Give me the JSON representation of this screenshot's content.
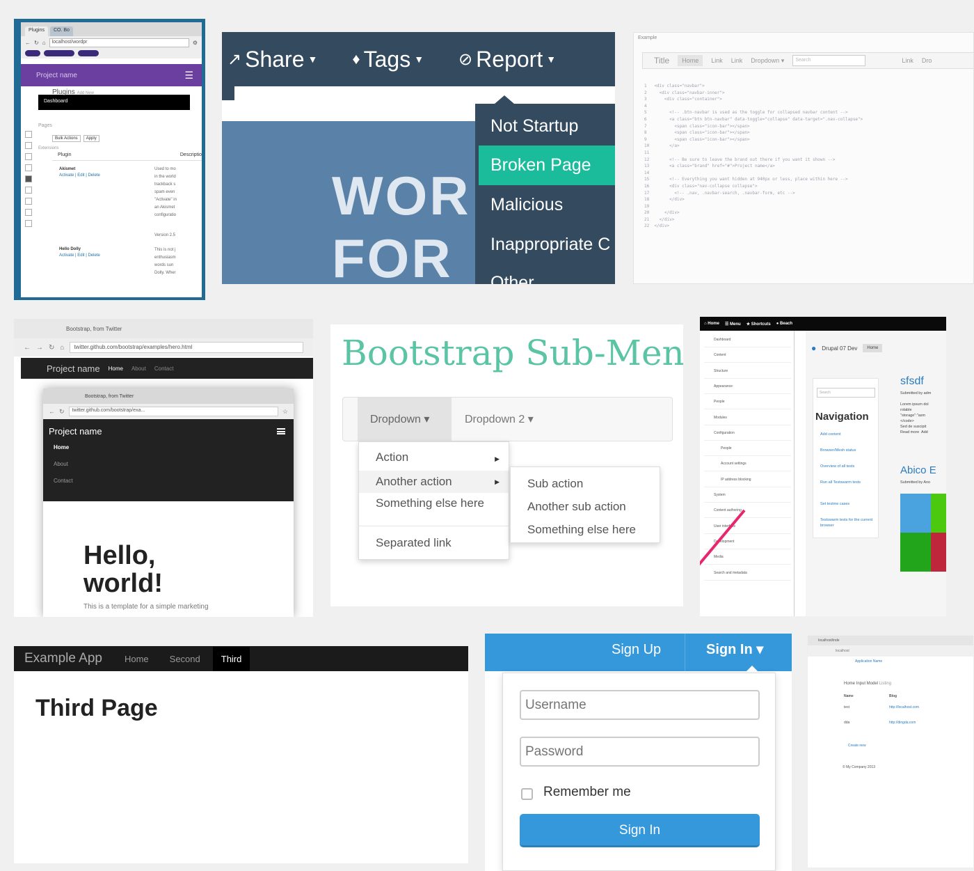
{
  "tile_wp": {
    "tabs": [
      "Plugins",
      "CO. Bo"
    ],
    "url": "localhost/wordpr",
    "brand": "Project name",
    "sub": "Plugins",
    "sub_extra": "Add New",
    "dashboard": "Dashboard",
    "pages_label": "Pages",
    "bulk": "Bulk Actions",
    "apply": "Apply",
    "extensions_label": "Extensions",
    "col_plugin": "Plugin",
    "col_desc": "Descriptio",
    "plugin1": "Akismet",
    "plugin1_links": "Activate | Edit | Delete",
    "plugin1_desc": "Used to mo\nin the world\ntrackback s\nspam even\n\"Activate\" in\nan Akismet\nconfiguratio",
    "plugin1_version": "Version 2.5",
    "plugin2": "Hello Dolly",
    "plugin2_links": "Activate | Edit | Delete",
    "plugin2_desc": "This is not j\nenthusiasm\nwords sun\nDolly. Wher"
  },
  "tile_share": {
    "nav": [
      {
        "label": "Share",
        "icon": "share-icon"
      },
      {
        "label": "Tags",
        "icon": "tag-icon"
      },
      {
        "label": "Report",
        "icon": "ban-icon"
      }
    ],
    "bg_text_1": "WOR",
    "bg_text_2": "FOR",
    "menu": [
      "Not Startup",
      "Broken Page",
      "Malicious",
      "Inappropriate C",
      "Other"
    ],
    "active_index": 1,
    "accent": "#1abc9c",
    "navbar_color": "#344a5e"
  },
  "tile_code": {
    "label": "Example",
    "nav": [
      "Title",
      "Home",
      "Link",
      "Link",
      "Dropdown ▾"
    ],
    "search_placeholder": "Search",
    "right_links": [
      "Link",
      "Dro"
    ],
    "lines": [
      "1   <div class=\"navbar\">",
      "2     <div class=\"navbar-inner\">",
      "3       <div class=\"container\">",
      "4 ",
      "5         <!-- .btn-navbar is used as the toggle for collapsed navbar content -->",
      "6         <a class=\"btn btn-navbar\" data-toggle=\"collapse\" data-target=\".nav-collapse\">",
      "7           <span class=\"icon-bar\"></span>",
      "8           <span class=\"icon-bar\"></span>",
      "9           <span class=\"icon-bar\"></span>",
      "10        </a>",
      "11",
      "12        <!-- Be sure to leave the brand out there if you want it shown -->",
      "13        <a class=\"brand\" href=\"#\">Project name</a>",
      "14",
      "15        <!-- Everything you want hidden at 940px or less, place within here -->",
      "16        <div class=\"nav-collapse collapse\">",
      "17          <!-- .nav, .navbar-search, .navbar-form, etc -->",
      "18        </div>",
      "19",
      "20      </div>",
      "21    </div>",
      "22  </div>"
    ]
  },
  "tile_twitter": {
    "tab": "Bootstrap, from Twitter",
    "url": "twitter.github.com/bootstrap/examples/hero.html",
    "brand": "Project name",
    "links": [
      "Home",
      "About",
      "Contact"
    ],
    "inner_url": "twitter.github.com/bootstrap/exa...",
    "hero": "Hello, world!",
    "hero_sub": "This is a template for a simple marketing"
  },
  "tile_submenu": {
    "title": "Bootstrap Sub-Menu",
    "dropdown1": "Dropdown ▾",
    "dropdown2": "Dropdown 2 ▾",
    "menu": [
      "Action",
      "Another action",
      "Something else here",
      "Separated link"
    ],
    "submenu": [
      "Sub action",
      "Another sub action",
      "Something else here"
    ],
    "title_color": "#5bc4a4"
  },
  "tile_drupal": {
    "toolbar": [
      "Home",
      "Menu",
      "Shortcuts",
      "Beach"
    ],
    "side_items": [
      "Dashboard",
      "Content",
      "Structure",
      "Appearance",
      "People",
      "Modules",
      "Configuration",
      "People",
      "Account settings",
      "IP address blocking",
      "System",
      "Content authoring",
      "User interface",
      "Development",
      "Media",
      "Search and metadata"
    ],
    "site": "Drupal 07 Dev",
    "home": "Home",
    "search": "Search",
    "nav_title": "Navigation",
    "nav_links": [
      "Add content",
      "Browser/Mesh status",
      "Overview of all tests",
      "Run all Testswarm tests",
      "Set testme cases",
      "Testswarm tests for the current browser"
    ],
    "post1": "sfsdf",
    "post1_meta": "Submitted by adm",
    "post1_body": "Lorem ipsum dol\nrolable\n\"storage\":\"asm\n</code>\nSed de suscipit\nRead more  Add",
    "post2": "Abico E",
    "post2_meta": "Submitted by Ano",
    "arrow_color": "#e8256d"
  },
  "tile_example": {
    "brand": "Example App",
    "links": [
      "Home",
      "Second",
      "Third"
    ],
    "heading": "Third Page"
  },
  "tile_signin": {
    "signup": "Sign Up",
    "signin": "Sign In ▾",
    "username_placeholder": "Username",
    "password_placeholder": "Password",
    "remember": "Remember me",
    "button": "Sign In",
    "accent": "#3498db"
  },
  "tile_table": {
    "tab": "localhost/inde",
    "url": "localhost",
    "crumb": "Application Name",
    "title": "Home Input Model",
    "subtitle": "Listing",
    "cols": [
      "Name",
      "Blog"
    ],
    "rows": [
      [
        "test",
        "http://localhost.com"
      ],
      [
        "dda",
        "http://dingda.com"
      ]
    ],
    "create": "Create new",
    "footer": "© My Company 2013"
  }
}
